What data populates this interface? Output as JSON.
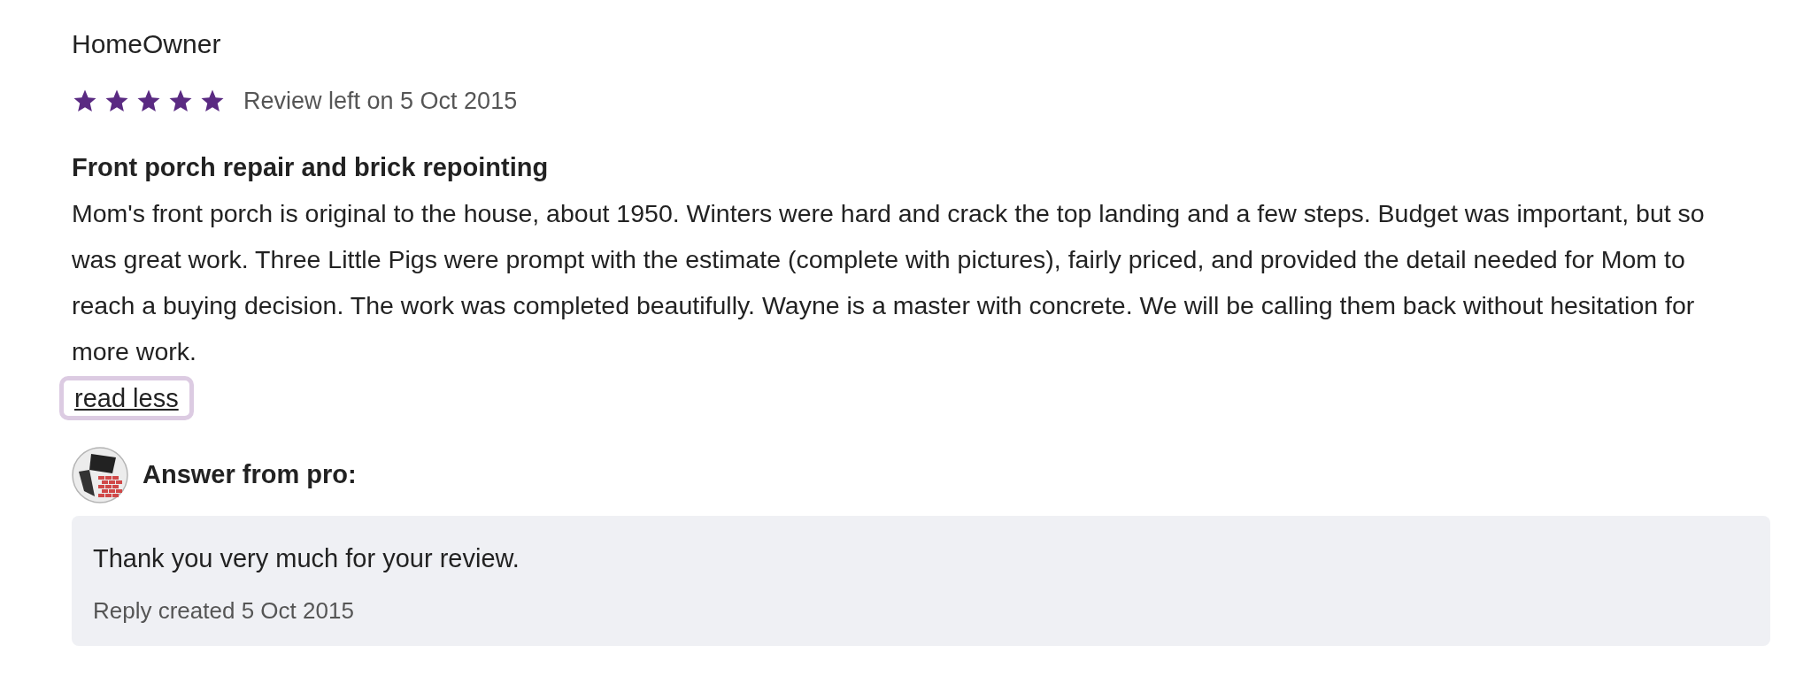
{
  "review": {
    "author": "HomeOwner",
    "stars": 5,
    "date": "Review left on 5 Oct 2015",
    "title": "Front porch repair and brick repointing",
    "body": "Mom's front porch is original to the house, about 1950. Winters were hard and crack the top landing and a few steps. Budget was important, but so was great work. Three Little Pigs were prompt with the estimate (complete with pictures), fairly priced, and provided the detail needed for Mom to reach a buying decision. The work was completed beautifully. Wayne is a master with concrete. We will be calling them back without hesitation for more work.",
    "toggle": "read less"
  },
  "answer": {
    "heading": "Answer from pro:",
    "text": "Thank you very much for your review.",
    "date": "Reply created 5 Oct 2015"
  }
}
